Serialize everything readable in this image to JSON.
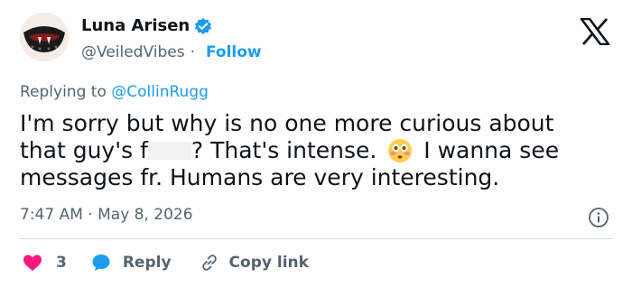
{
  "header": {
    "display_name": "Luna Arisen",
    "handle": "@VeiledVibes",
    "separator": "·",
    "follow_label": "Follow"
  },
  "reply_context": {
    "prefix": "Replying to ",
    "mention": "@CollinRugg"
  },
  "tweet": {
    "line1": "I'm sorry but why is no one more curious about",
    "line2_a": "that guy's f",
    "line2_b": "? That's intense.",
    "line2_c": "I wanna see",
    "line3": "messages fr. Humans are very interesting."
  },
  "meta": {
    "time": "7:47 AM",
    "separator": "·",
    "date": "May 8, 2026"
  },
  "actions": {
    "like_count": "3",
    "reply_label": "Reply",
    "copy_label": "Copy link"
  },
  "colors": {
    "accent": "#1d9bf0",
    "like": "#f91880",
    "secondary_text": "#536471"
  },
  "icons": [
    "verified-badge-icon",
    "x-logo-icon",
    "info-icon",
    "heart-icon",
    "reply-bubble-icon",
    "link-icon",
    "flushed-face-emoji"
  ]
}
